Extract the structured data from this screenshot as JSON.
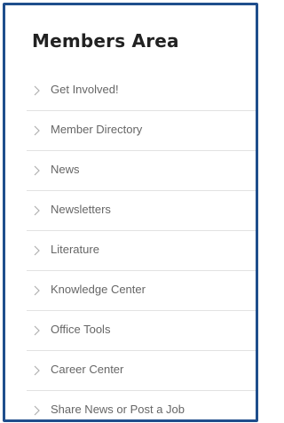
{
  "panel": {
    "title": "Members Area",
    "items": [
      {
        "label": "Get Involved!",
        "icon": "chevron-right-icon"
      },
      {
        "label": "Member Directory",
        "icon": "chevron-right-icon"
      },
      {
        "label": "News",
        "icon": "chevron-right-icon"
      },
      {
        "label": "Newsletters",
        "icon": "chevron-right-icon"
      },
      {
        "label": "Literature",
        "icon": "chevron-right-icon"
      },
      {
        "label": "Knowledge Center",
        "icon": "chevron-right-icon"
      },
      {
        "label": "Office Tools",
        "icon": "chevron-right-icon"
      },
      {
        "label": "Career Center",
        "icon": "chevron-right-icon"
      },
      {
        "label": "Share News or Post a Job",
        "icon": "chevron-right-icon"
      }
    ]
  },
  "colors": {
    "border": "#1f4e8c",
    "title": "#222222",
    "label": "#666666",
    "divider": "#e2e2e2",
    "chevron": "#b0b0b0"
  }
}
